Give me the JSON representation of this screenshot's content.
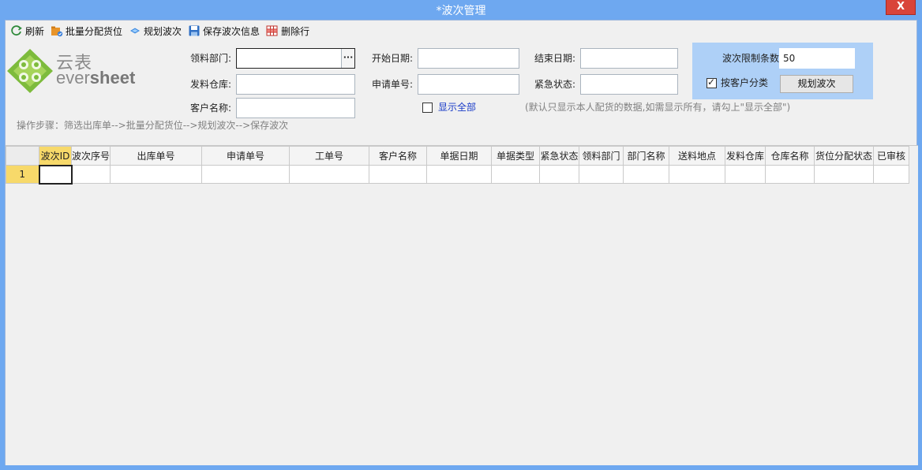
{
  "window": {
    "title": "*波次管理",
    "close_label": "X"
  },
  "toolbar": {
    "refresh": "刷新",
    "batch_assign": "批量分配货位",
    "plan_wave": "规划波次",
    "save_wave": "保存波次信息",
    "delete_row": "删除行"
  },
  "logo": {
    "cn": "云表",
    "en_prefix": "ever",
    "en_suffix": "sheet"
  },
  "filters": {
    "dept_label": "领料部门:",
    "dept_value": "",
    "warehouse_label": "发料仓库:",
    "warehouse_value": "",
    "customer_label": "客户名称:",
    "customer_value": "",
    "start_date_label": "开始日期:",
    "start_date_value": "",
    "apply_no_label": "申请单号:",
    "apply_no_value": "",
    "end_date_label": "结束日期:",
    "end_date_value": "",
    "urgent_label": "紧急状态:",
    "urgent_value": "",
    "show_all_label": "显示全部",
    "hint": "(默认只显示本人配货的数据,如需显示所有，请勾上\"显示全部\")",
    "steps": "操作步骤：筛选出库单-->批量分配货位-->规划波次-->保存波次"
  },
  "plan": {
    "limit_label": "波次限制条数",
    "limit_value": "50",
    "by_customer_label": "按客户分类",
    "by_customer_checked": true,
    "plan_button": "规划波次"
  },
  "grid": {
    "columns": [
      "波次ID",
      "波次序号",
      "出库单号",
      "申请单号",
      "工单号",
      "客户名称",
      "单据日期",
      "单据类型",
      "紧急状态",
      "领料部门",
      "部门名称",
      "送料地点",
      "发料仓库",
      "仓库名称",
      "货位分配状态",
      "已审核"
    ],
    "rows": [
      {
        "index": "1",
        "cells": [
          "",
          "",
          "",
          "",
          "",
          "",
          "",
          "",
          "",
          "",
          "",
          "",
          "",
          "",
          "",
          ""
        ]
      }
    ]
  }
}
